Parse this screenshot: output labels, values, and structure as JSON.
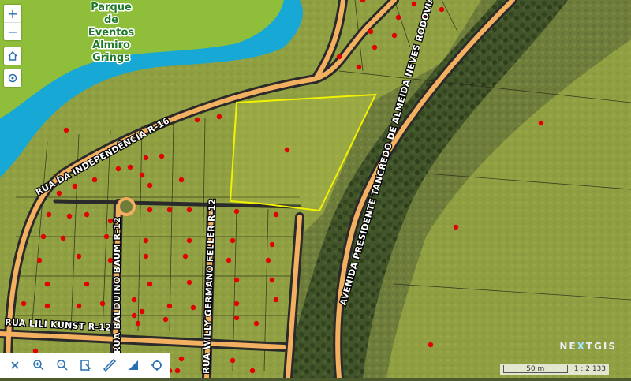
{
  "map": {
    "place_label": [
      "Parque",
      "de",
      "Eventos",
      "Almiro",
      "Grings"
    ],
    "roads": {
      "independencia": "RUA DA INDEPENDÊNCIA R-16",
      "balduino": "RUA BALDUINO BAUM R-12",
      "willy": "RUA WILLY GERMANO FELLER R-12",
      "lili": "RUA LILI KUNST R-12",
      "avenida": "AVENIDA PRESIDENTE TANCREDO DE ALMEIDA NEVES RODOVIA"
    },
    "selection_color": "#f2f200",
    "water_color": "#17a8d6",
    "parcel_fill_color": "#c9d85a",
    "marker_color": "#e20000"
  },
  "controls": {
    "zoom_in": "+",
    "zoom_out": "−",
    "home_icon": "home-icon",
    "locate_icon": "target-icon"
  },
  "toolbar": {
    "icons": [
      "close-icon",
      "zoom-in-icon",
      "zoom-out-icon",
      "identify-icon",
      "ruler-icon",
      "area-icon",
      "locate-icon"
    ]
  },
  "branding": {
    "logo_main": "N",
    "logo_x": "X",
    "logo_end": "TGIS",
    "logo_mid": "E"
  },
  "scale": {
    "bar_label": "50 m",
    "ratio": "1 : 2 133"
  }
}
